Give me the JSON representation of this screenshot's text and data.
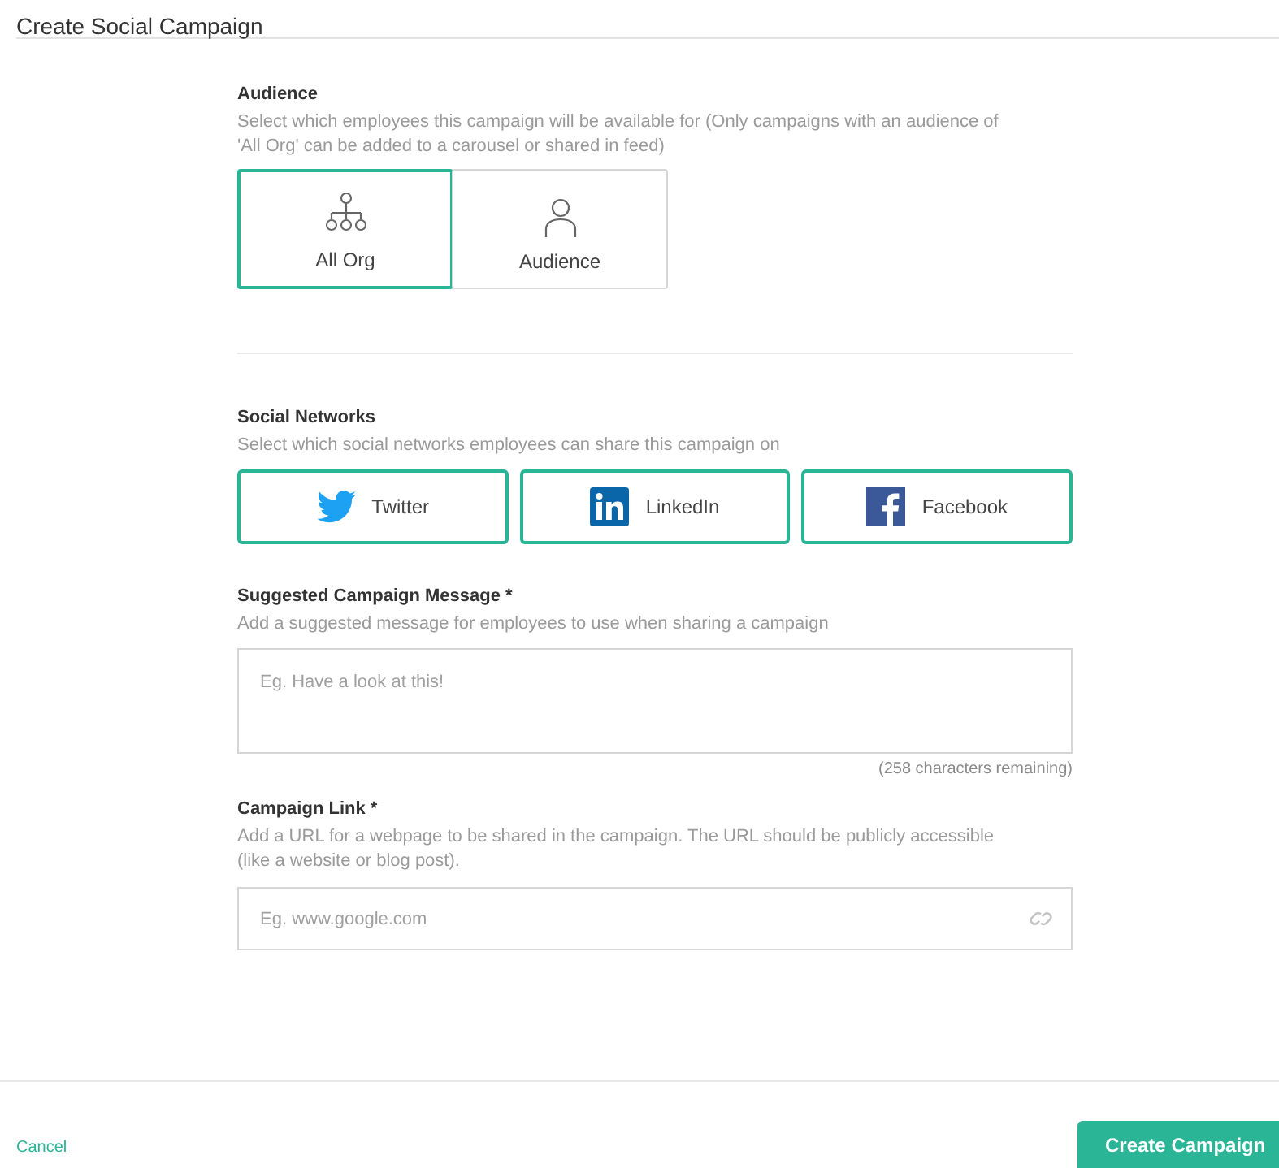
{
  "header": {
    "title": "Create Social Campaign"
  },
  "audience": {
    "heading": "Audience",
    "description": "Select which employees this campaign will be available for (Only campaigns with an audience of 'All Org' can be added to a carousel or shared in feed)",
    "options": [
      {
        "kind": "org",
        "label": "All Org",
        "selected": true
      },
      {
        "kind": "person",
        "label": "Audience",
        "selected": false
      }
    ]
  },
  "social_networks": {
    "heading": "Social Networks",
    "description": "Select which social networks employees can share this campaign on",
    "networks": [
      {
        "kind": "twitter",
        "label": "Twitter",
        "selected": true
      },
      {
        "kind": "linkedin",
        "label": "LinkedIn",
        "selected": true
      },
      {
        "kind": "facebook",
        "label": "Facebook",
        "selected": true
      }
    ]
  },
  "message": {
    "heading": "Suggested Campaign Message *",
    "description": "Add a suggested message for employees to use when sharing a campaign",
    "placeholder": "Eg. Have a look at this!",
    "counter": "(258 characters remaining)"
  },
  "link": {
    "heading": "Campaign Link *",
    "description": "Add a URL for a webpage to be shared in the campaign. The URL should be publicly accessible (like a website or blog post).",
    "placeholder": "Eg. www.google.com"
  },
  "footer": {
    "cancel": "Cancel",
    "submit": "Create Campaign"
  }
}
